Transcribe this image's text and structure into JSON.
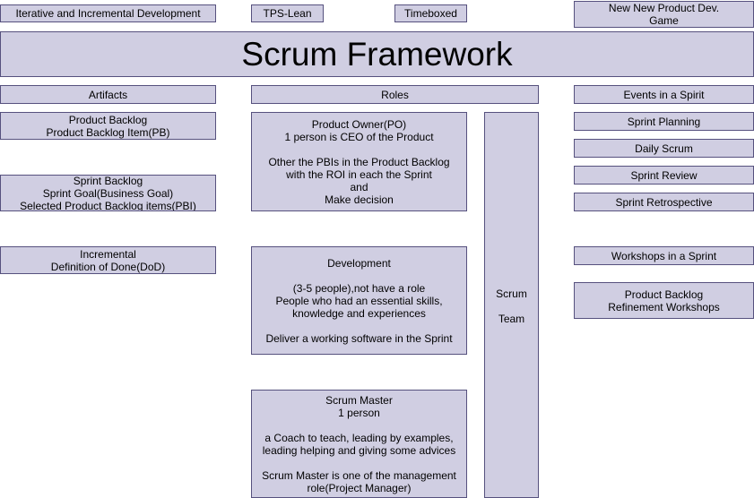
{
  "top_row": {
    "iterative": "Iterative and Incremental Development",
    "tps_lean": "TPS-Lean",
    "timeboxed": "Timeboxed",
    "new_product": "New New Product Dev.\nGame"
  },
  "title": "Scrum Framework",
  "headers": {
    "artifacts": "Artifacts",
    "roles": "Roles",
    "events": "Events in a Spirit"
  },
  "artifacts": {
    "product_backlog": "Product Backlog\nProduct Backlog Item(PB)",
    "sprint_backlog": "Sprint Backlog\nSprint Goal(Business Goal)\nSelected Product Backlog items(PBI)",
    "incremental": "Incremental\nDefinition of Done(DoD)"
  },
  "roles": {
    "product_owner": "Product Owner(PO)\n1 person is CEO of the Product\n\nOther the PBIs in the Product Backlog\nwith the ROI in each the Sprint\nand\nMake decision",
    "development": "Development\n\n(3-5 people),not have a role\nPeople who had an essential skills,\nknowledge and experiences\n\nDeliver a working software in the Sprint",
    "scrum_master": "Scrum Master\n1 person\n\na Coach to teach, leading by examples,\nleading helping and giving some advices\n\nScrum Master is one of the management\nrole(Project Manager)",
    "scrum_team": "Scrum\n\nTeam"
  },
  "events": {
    "sprint_planning": "Sprint Planning",
    "daily_scrum": "Daily Scrum",
    "sprint_review": "Sprint Review",
    "sprint_retrospective": "Sprint Retrospective"
  },
  "workshops": {
    "header": "Workshops in a Sprint",
    "refinement": "Product Backlog\nRefinement Workshops"
  },
  "colors": {
    "box_fill": "#d0cee2",
    "box_border": "#56517e"
  }
}
